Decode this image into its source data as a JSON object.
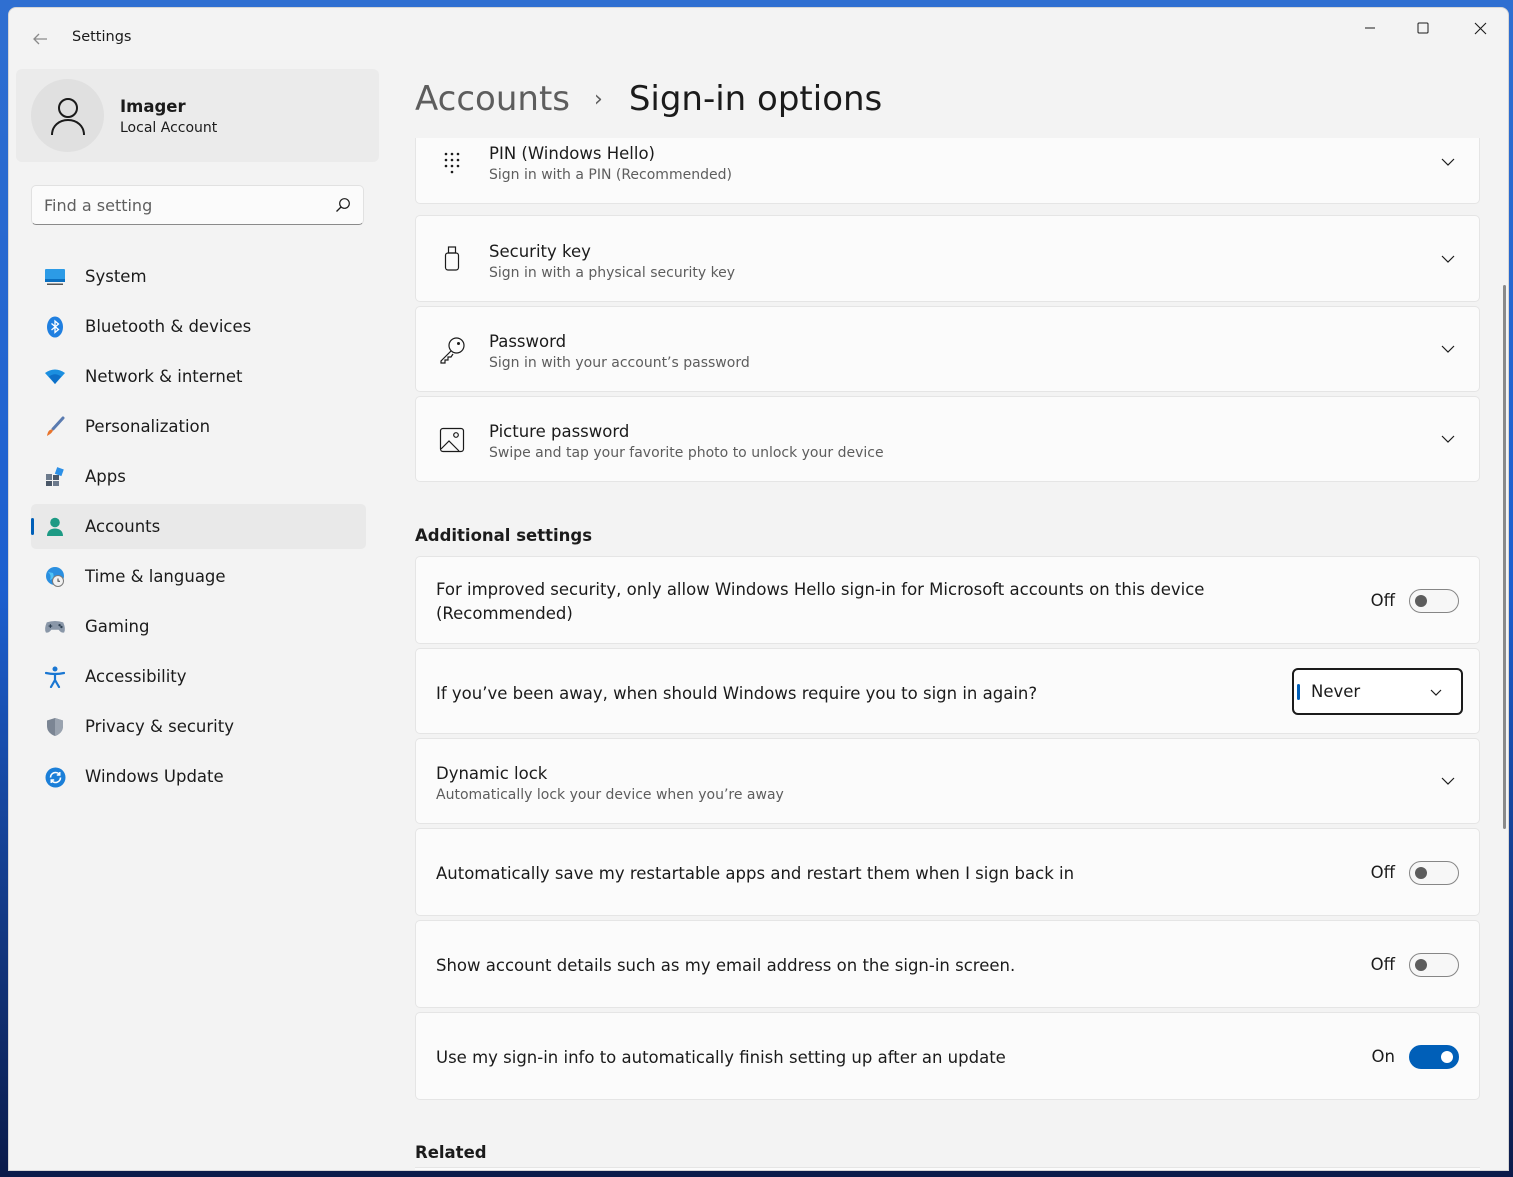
{
  "window": {
    "title": "Settings"
  },
  "profile": {
    "name": "Imager",
    "account_type": "Local Account"
  },
  "search": {
    "placeholder": "Find a setting"
  },
  "sidebar": {
    "items": [
      {
        "label": "System",
        "icon": "system-icon"
      },
      {
        "label": "Bluetooth & devices",
        "icon": "bluetooth-icon"
      },
      {
        "label": "Network & internet",
        "icon": "wifi-icon"
      },
      {
        "label": "Personalization",
        "icon": "brush-icon"
      },
      {
        "label": "Apps",
        "icon": "apps-icon"
      },
      {
        "label": "Accounts",
        "icon": "person-icon",
        "active": true
      },
      {
        "label": "Time & language",
        "icon": "globe-clock-icon"
      },
      {
        "label": "Gaming",
        "icon": "controller-icon"
      },
      {
        "label": "Accessibility",
        "icon": "accessibility-icon"
      },
      {
        "label": "Privacy & security",
        "icon": "shield-icon"
      },
      {
        "label": "Windows Update",
        "icon": "update-icon"
      }
    ]
  },
  "breadcrumb": {
    "parent": "Accounts",
    "separator": "›",
    "current": "Sign-in options"
  },
  "sign_in_methods": [
    {
      "title": "PIN (Windows Hello)",
      "subtitle": "Sign in with a PIN (Recommended)",
      "icon": "keypad-icon"
    },
    {
      "title": "Security key",
      "subtitle": "Sign in with a physical security key",
      "icon": "usb-key-icon"
    },
    {
      "title": "Password",
      "subtitle": "Sign in with your account’s password",
      "icon": "key-icon"
    },
    {
      "title": "Picture password",
      "subtitle": "Swipe and tap your favorite photo to unlock your device",
      "icon": "picture-icon"
    }
  ],
  "additional": {
    "heading": "Additional settings",
    "hello_only": {
      "line1": "For improved security, only allow Windows Hello sign-in for Microsoft accounts on this device",
      "line2": "(Recommended)",
      "state_label": "Off",
      "on": false
    },
    "require_signin": {
      "text": "If you’ve been away, when should Windows require you to sign in again?",
      "selected": "Never"
    },
    "dynamic_lock": {
      "title": "Dynamic lock",
      "subtitle": "Automatically lock your device when you’re away"
    },
    "restart_apps": {
      "text": "Automatically save my restartable apps and restart them when I sign back in",
      "state_label": "Off",
      "on": false
    },
    "account_details": {
      "text": "Show account details such as my email address on the sign-in screen.",
      "state_label": "Off",
      "on": false
    },
    "signin_info": {
      "text": "Use my sign-in info to automatically finish setting up after an update",
      "state_label": "On",
      "on": true
    }
  },
  "related": {
    "heading": "Related"
  },
  "colors": {
    "accent": "#005fb8",
    "background": "#f3f3f3",
    "card": "#fbfbfb"
  }
}
